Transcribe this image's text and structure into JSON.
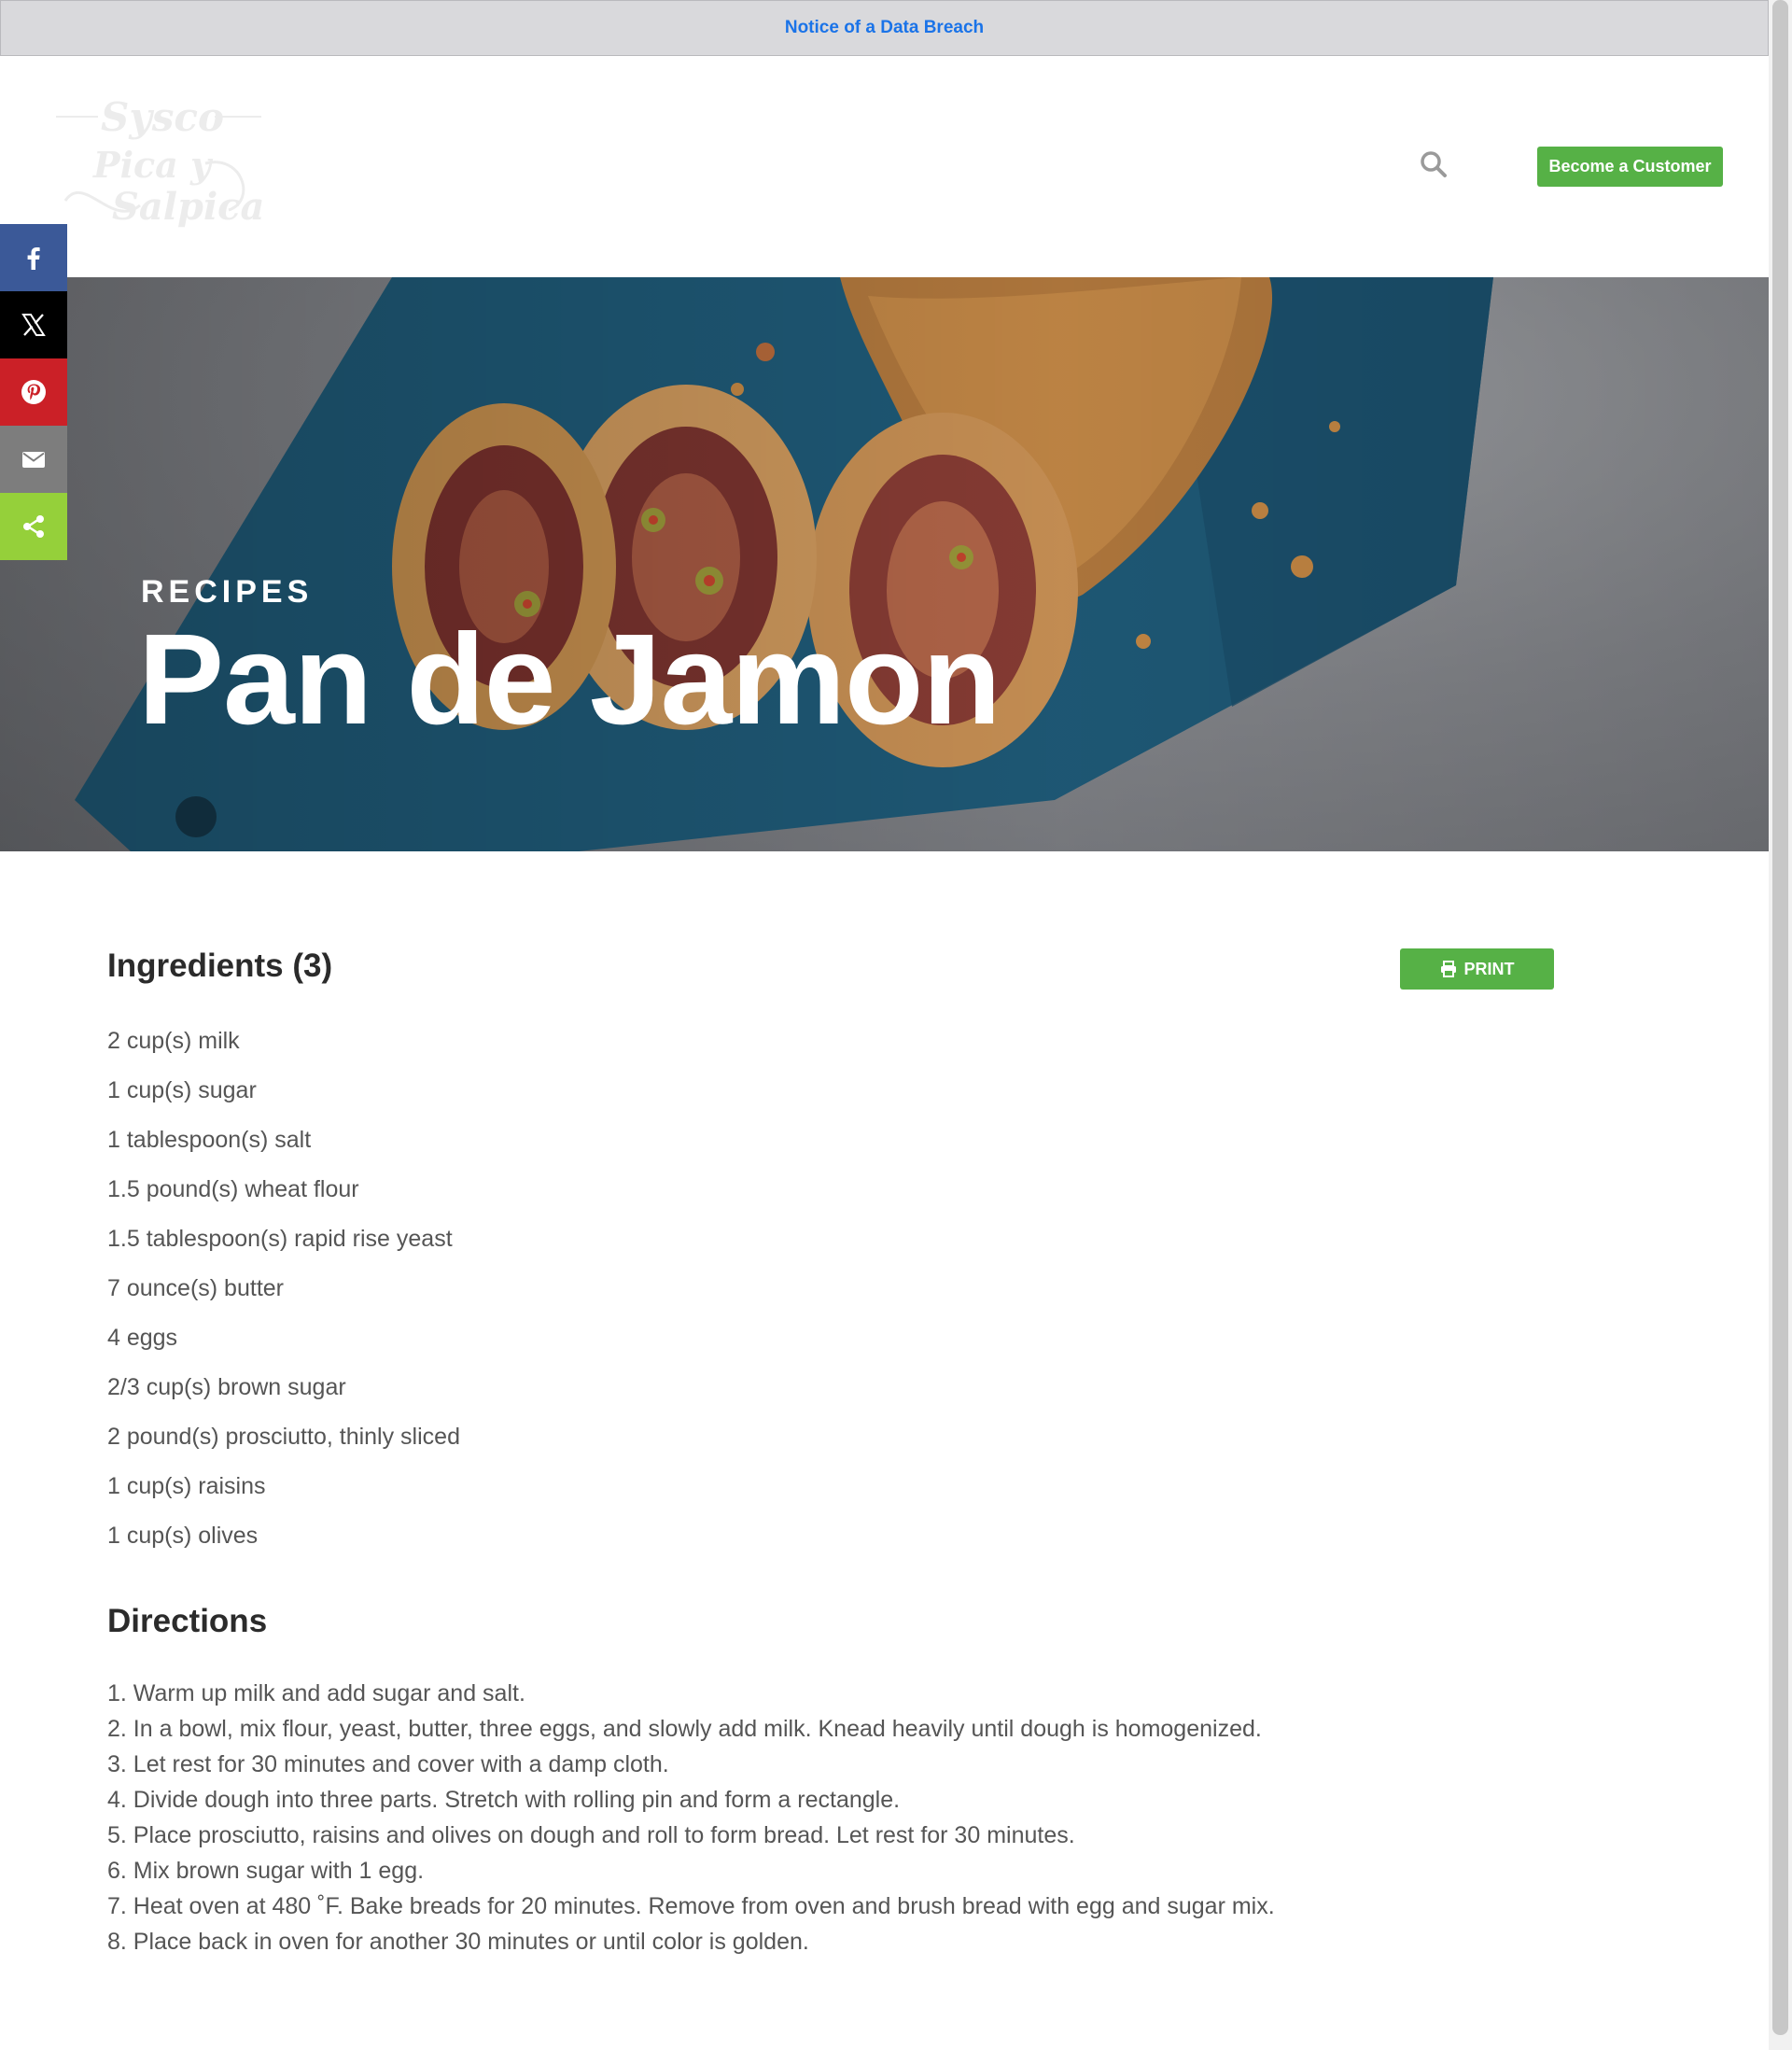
{
  "notice": {
    "label": "Notice of a Data Breach"
  },
  "header": {
    "logo_text": [
      "Sysco",
      "Pica y",
      "Salpica"
    ],
    "customer_button": "Become a Customer"
  },
  "hero": {
    "eyebrow": "RECIPES",
    "title": "Pan de Jamon"
  },
  "social": [
    {
      "name": "facebook",
      "icon": "facebook-icon",
      "color": "#3b5998"
    },
    {
      "name": "x",
      "icon": "x-icon",
      "color": "#000000"
    },
    {
      "name": "pinterest",
      "icon": "pinterest-icon",
      "color": "#cb2027"
    },
    {
      "name": "email",
      "icon": "mail-icon",
      "color": "#7d7d7d"
    },
    {
      "name": "share",
      "icon": "share-icon",
      "color": "#95d03a"
    }
  ],
  "ingredients": {
    "title": "Ingredients (3)",
    "print_label": "PRINT",
    "items": [
      "2 cup(s) milk",
      "1 cup(s) sugar",
      "1 tablespoon(s) salt",
      "1.5 pound(s) wheat flour",
      "1.5 tablespoon(s) rapid rise yeast",
      "7 ounce(s) butter",
      "4 eggs",
      "2/3 cup(s) brown sugar",
      "2 pound(s) prosciutto, thinly sliced",
      "1 cup(s) raisins",
      "1 cup(s) olives"
    ]
  },
  "directions": {
    "title": "Directions",
    "steps": [
      "1. Warm up milk and add sugar and salt.",
      "2. In a bowl, mix flour, yeast, butter, three eggs, and slowly add milk. Knead heavily until dough is homogenized.",
      "3. Let rest for 30 minutes and cover with a damp cloth.",
      "4. Divide dough into three parts. Stretch with rolling pin and form a rectangle.",
      "5. Place prosciutto, raisins and olives on dough and roll to form bread. Let rest for 30 minutes.",
      "6. Mix brown sugar with 1 egg.",
      "7. Heat oven at 480 ˚F. Bake breads for 20 minutes. Remove from oven and brush bread with egg and sugar mix.",
      "8. Place back in oven for another 30 minutes or until color is golden."
    ]
  },
  "colors": {
    "accent": "#56b146",
    "link": "#1a73e8",
    "notice_bg": "#d9d9dc",
    "board": "#1f5b79"
  }
}
